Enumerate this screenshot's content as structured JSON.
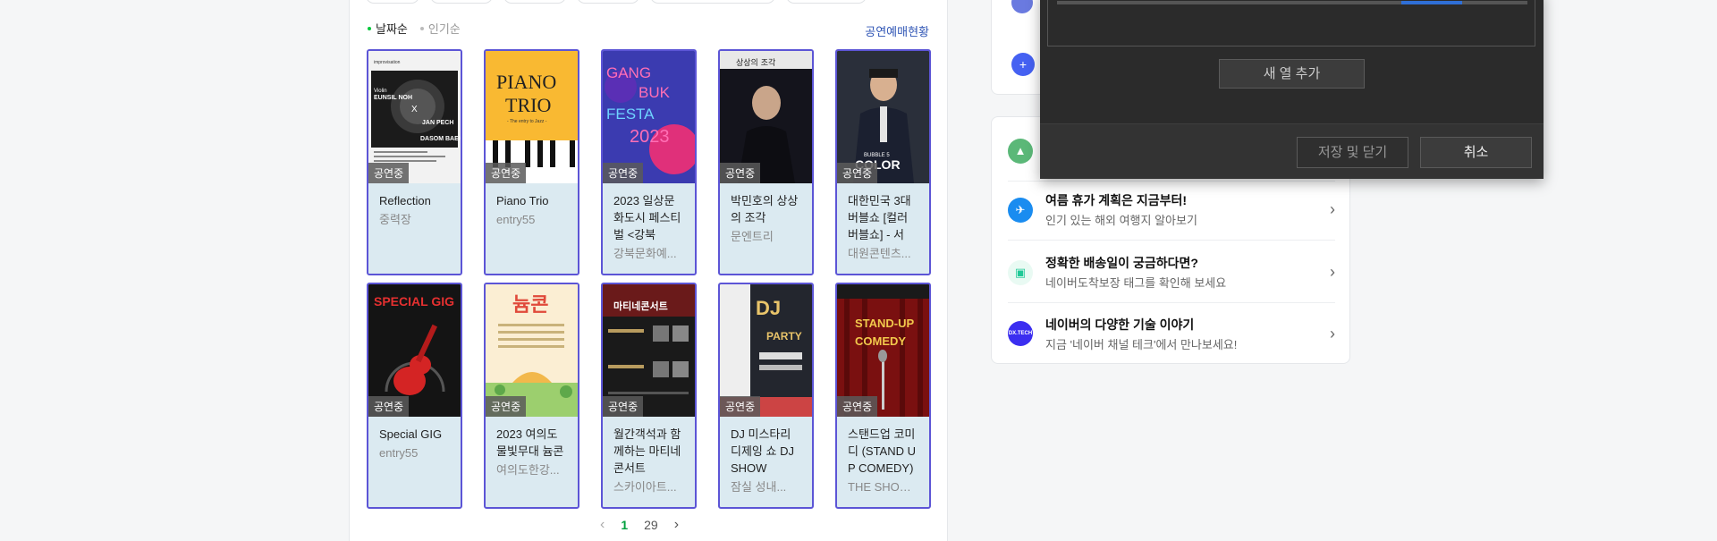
{
  "sort": {
    "by_date": "날짜순",
    "by_popularity": "인기순",
    "status_link": "공연예매현황"
  },
  "cards": [
    {
      "badge": "공연중",
      "title": "Reflection",
      "sub": "중력장"
    },
    {
      "badge": "공연중",
      "title": "Piano Trio",
      "sub": "entry55"
    },
    {
      "badge": "공연중",
      "title": "2023 일상문화도시 페스티벌 <강북",
      "sub": "강북문화예..."
    },
    {
      "badge": "공연중",
      "title": "박민호의 상상의 조각",
      "sub": "문엔트리"
    },
    {
      "badge": "공연중",
      "title": "대한민국 3대 버블쇼 [컬러 버블쇼] - 서",
      "sub": "대원콘텐츠..."
    },
    {
      "badge": "공연중",
      "title": "Special GIG",
      "sub": "entry55"
    },
    {
      "badge": "공연중",
      "title": "2023 여의도 물빛무대 늄콘",
      "sub": "여의도한강..."
    },
    {
      "badge": "공연중",
      "title": "월간객석과 함께하는 마티네콘서트",
      "sub": "스카이아트..."
    },
    {
      "badge": "공연중",
      "title": "DJ 미스타리 디제잉 쇼 DJ SHOW",
      "sub": "잠실 성내..."
    },
    {
      "badge": "공연중",
      "title": "스탠드업 코미디 (STAND UP COMEDY)",
      "sub": "THE SHOW..."
    }
  ],
  "pager": {
    "current": "1",
    "total": "29"
  },
  "side": [
    {
      "title": "여름 휴가 계획은 지금부터!",
      "desc": "인기 있는 해외 여행지 알아보기",
      "icon": "✈",
      "color": "#1a8cf0"
    },
    {
      "title": "정확한 배송일이 궁금하다면?",
      "desc": "네이버도착보장 태그를 확인해 보세요",
      "icon": "▣",
      "color": "#20c997"
    },
    {
      "title": "네이버의 다양한 기술 이야기",
      "desc": "지금 '네이버 채널 테크'에서 만나보세요!",
      "icon": "DX.TECH",
      "color": "#3b2ef0"
    }
  ],
  "dialog": {
    "add_column": "새 열 추가",
    "save_close": "저장 및 닫기",
    "cancel": "취소"
  }
}
